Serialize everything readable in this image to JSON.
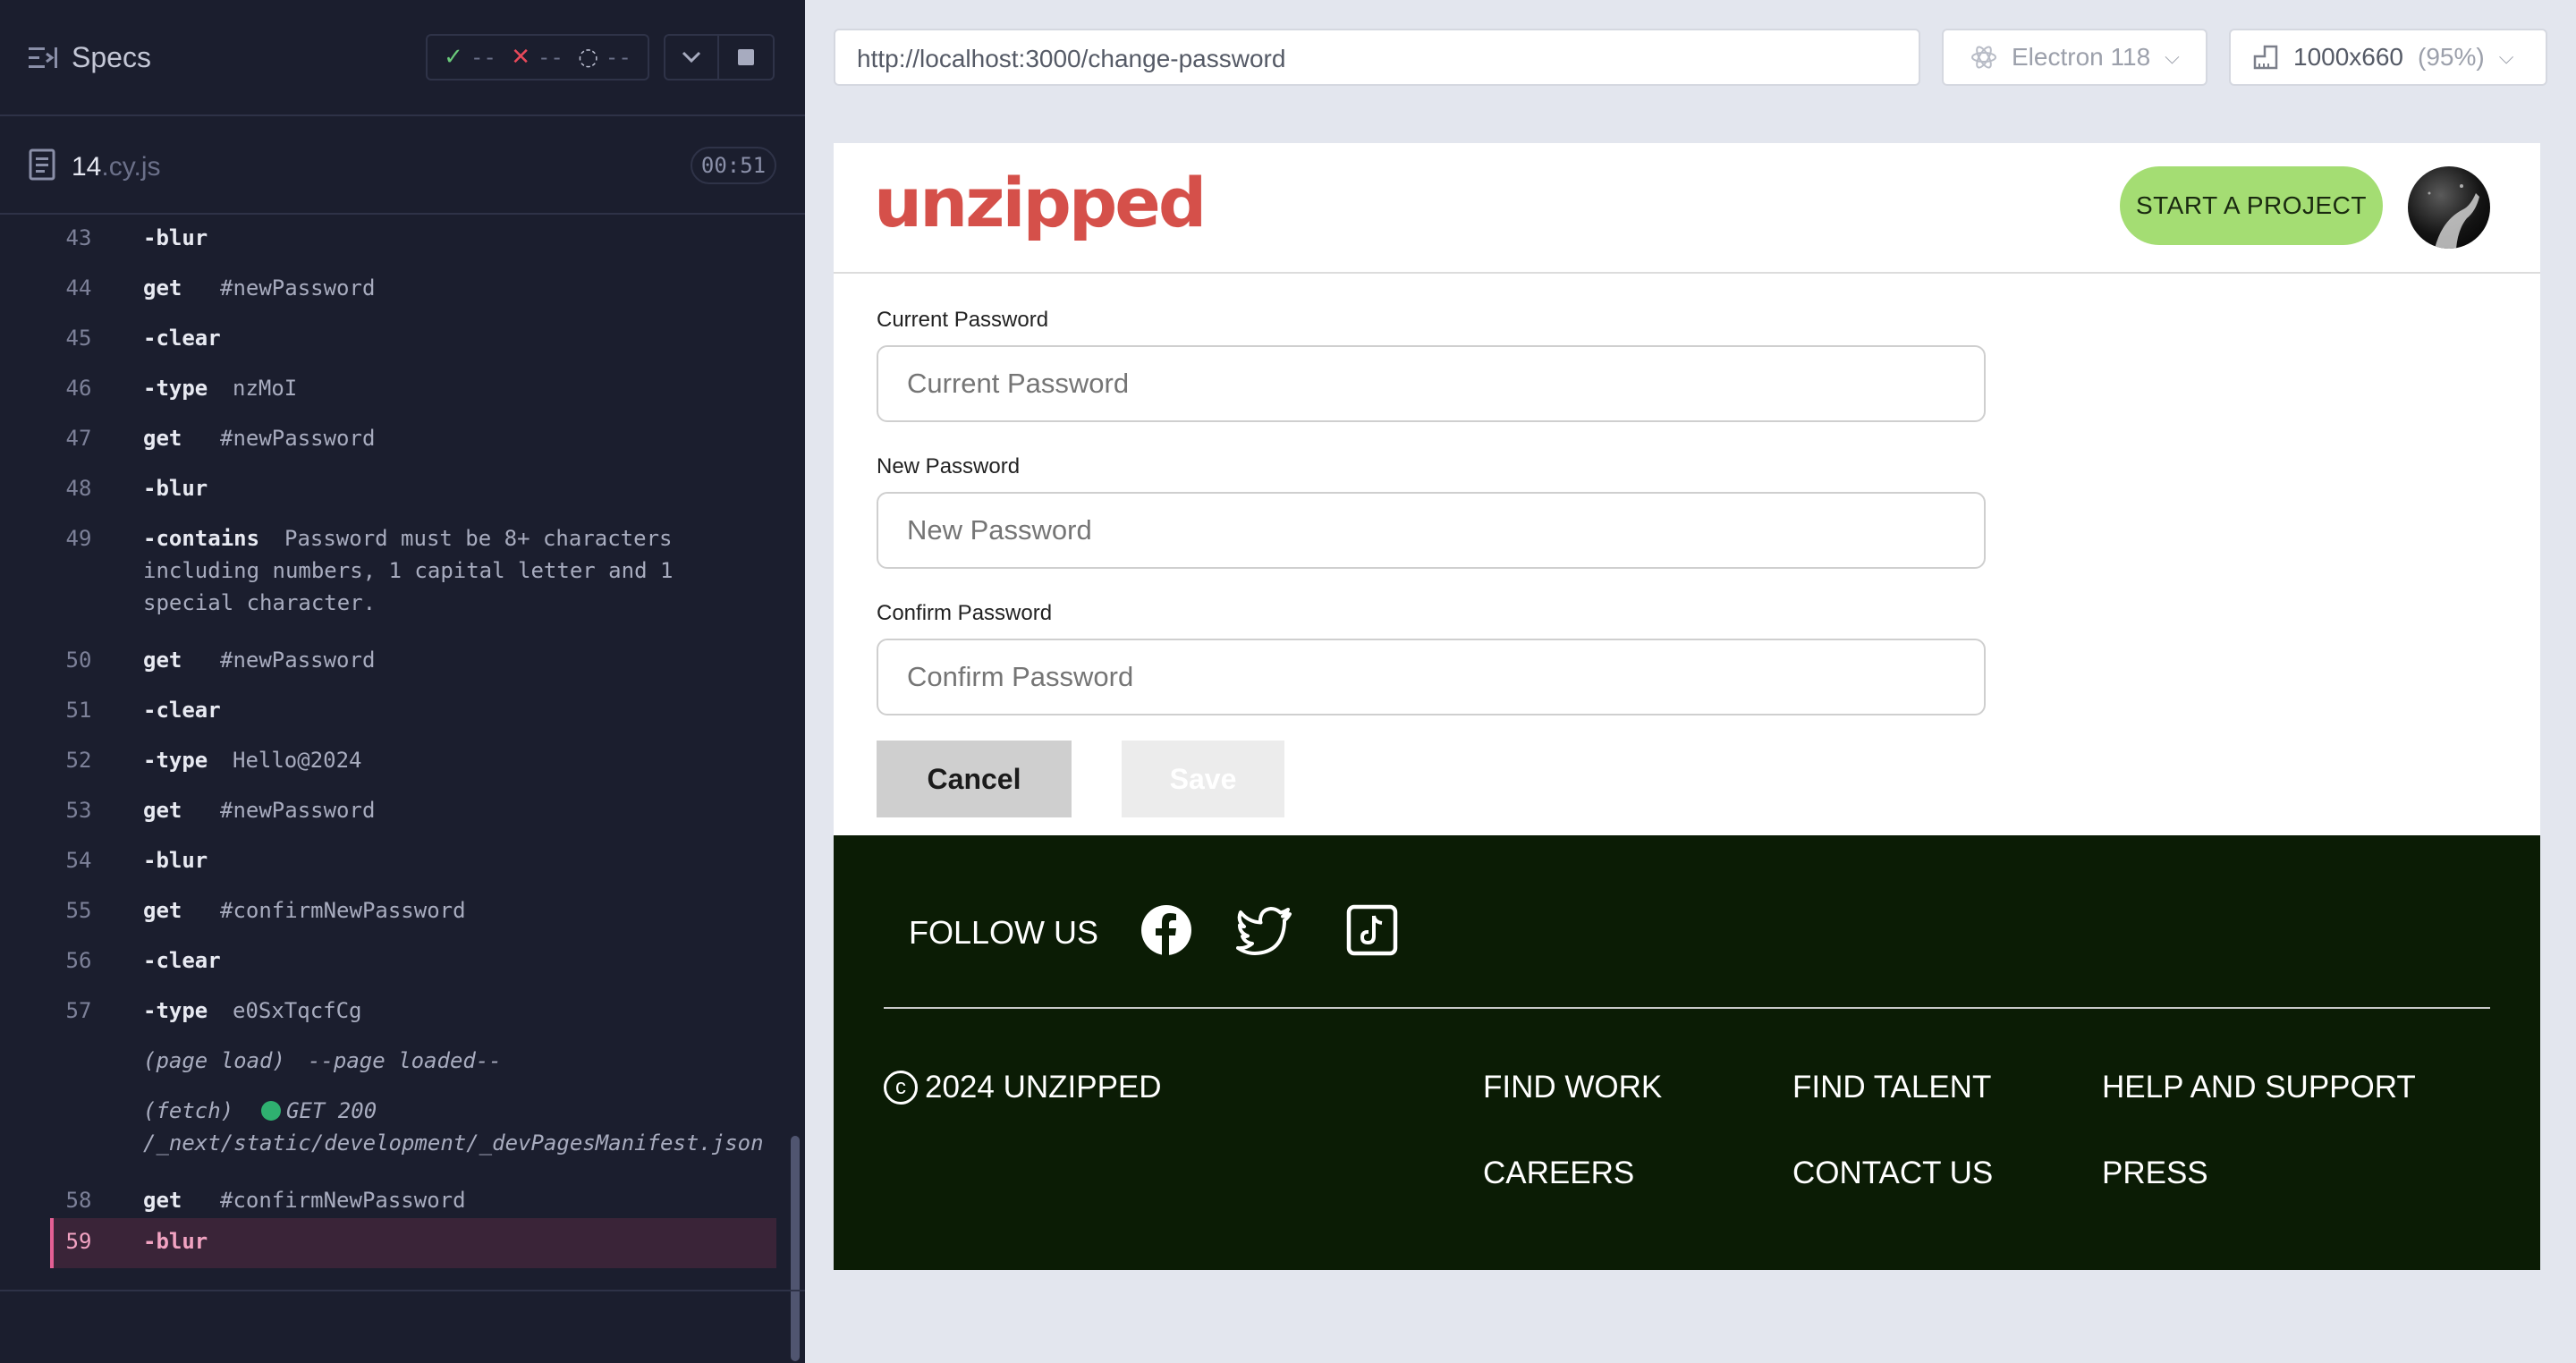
{
  "runner": {
    "title": "Specs",
    "stats": {
      "passed": "--",
      "failed": "--",
      "pending": "--"
    },
    "spec": {
      "name": "14",
      "ext": ".cy.js",
      "duration": "00:51"
    },
    "commands": [
      {
        "num": "43",
        "name": "-blur",
        "message": ""
      },
      {
        "num": "44",
        "name": "get",
        "message": "#newPassword"
      },
      {
        "num": "45",
        "name": "-clear",
        "message": ""
      },
      {
        "num": "46",
        "name": "-type",
        "message": "nzMoI"
      },
      {
        "num": "47",
        "name": "get",
        "message": "#newPassword"
      },
      {
        "num": "48",
        "name": "-blur",
        "message": ""
      },
      {
        "num": "49",
        "name": "-contains",
        "message_lines": [
          "Password must be 8+ characters",
          "including numbers, 1 capital letter and 1",
          "special character."
        ]
      },
      {
        "num": "50",
        "name": "get",
        "message": "#newPassword"
      },
      {
        "num": "51",
        "name": "-clear",
        "message": ""
      },
      {
        "num": "52",
        "name": "-type",
        "message": "Hello@2024"
      },
      {
        "num": "53",
        "name": "get",
        "message": "#newPassword"
      },
      {
        "num": "54",
        "name": "-blur",
        "message": ""
      },
      {
        "num": "55",
        "name": "get",
        "message": "#confirmNewPassword"
      },
      {
        "num": "56",
        "name": "-clear",
        "message": ""
      },
      {
        "num": "57",
        "name": "-type",
        "message": "e0SxTqcfCg"
      },
      {
        "event": "page-load",
        "name": "(page load)",
        "message": "--page loaded--"
      },
      {
        "event": "fetch",
        "name": "(fetch)",
        "message": "GET 200",
        "url": "/_next/static/development/_devPagesManifest.json"
      },
      {
        "num": "58",
        "name": "get",
        "message": "#confirmNewPassword"
      },
      {
        "num": "59",
        "name": "-blur",
        "message": "",
        "active": true
      }
    ]
  },
  "browser": {
    "url": "http://localhost:3000/change-password",
    "engine": "Electron 118",
    "viewport": "1000x660",
    "zoom": "(95%)"
  },
  "app": {
    "logo": "unzipped",
    "start_project": "START A PROJECT",
    "current_password": {
      "label": "Current Password",
      "placeholder": "Current Password"
    },
    "new_password": {
      "label": "New Password",
      "placeholder": "New Password"
    },
    "confirm_password": {
      "label": "Confirm Password",
      "placeholder": "Confirm Password"
    },
    "cancel": "Cancel",
    "save": "Save",
    "footer": {
      "follow": "FOLLOW US",
      "social_icons": [
        "facebook-icon",
        "twitter-icon",
        "tiktok-icon"
      ],
      "copyright": "2024 UNZIPPED",
      "links": [
        "FIND WORK",
        "FIND TALENT",
        "HELP AND SUPPORT",
        "CAREERS",
        "CONTACT US",
        "PRESS"
      ]
    }
  },
  "colors": {
    "runner_bg": "#1b1e2e",
    "active_row_bg": "#3a2438",
    "accent_pink": "#e45f94",
    "logo_red": "#d5504a",
    "start_btn_green": "#a4dd73",
    "footer_bg": "#0b1c05"
  }
}
